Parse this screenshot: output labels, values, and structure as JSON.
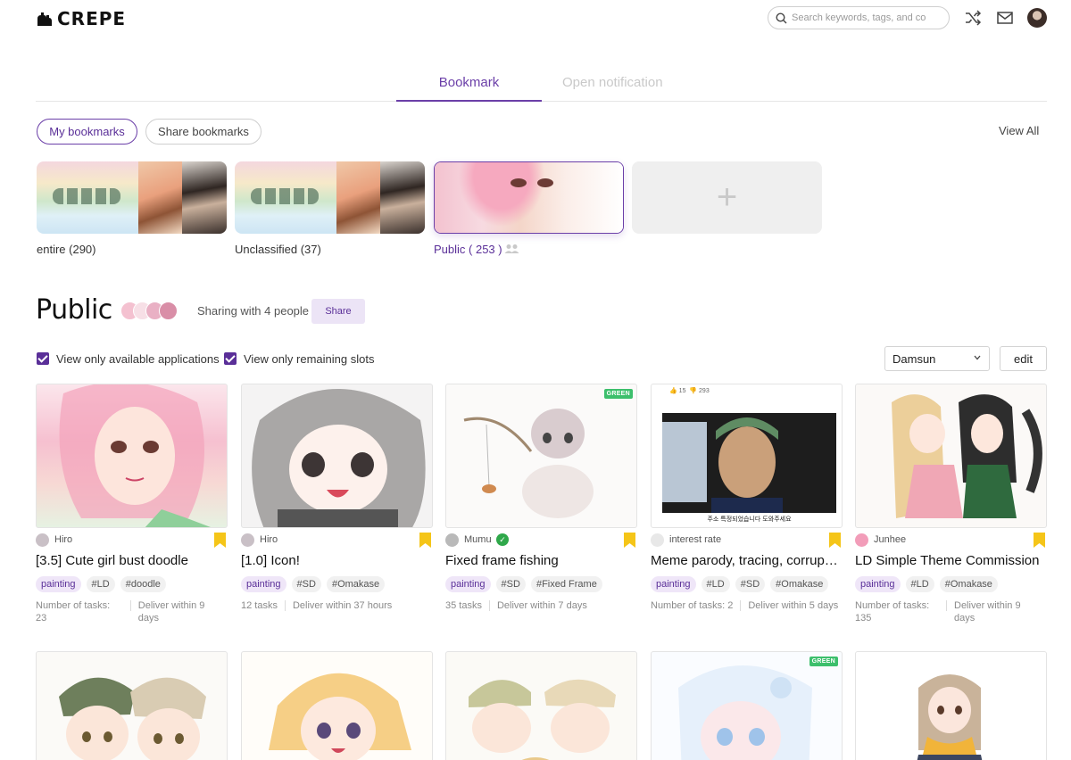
{
  "app": {
    "name": "CREPE"
  },
  "header": {
    "search_placeholder": "Search keywords, tags, and co"
  },
  "tabs": [
    {
      "label": "Bookmark",
      "active": true
    },
    {
      "label": "Open notification",
      "active": false
    }
  ],
  "bookmark_filters": {
    "my": "My bookmarks",
    "share": "Share bookmarks",
    "view_all": "View All"
  },
  "folders": [
    {
      "label": "entire (290)"
    },
    {
      "label": "Unclassified (37)"
    },
    {
      "label": "Public ( 253 )",
      "shared": true
    },
    {
      "label": "+"
    }
  ],
  "public": {
    "title": "Public",
    "sharing_text": "Sharing with 4 people",
    "share_button": "Share",
    "filter_available": "View only available applications",
    "filter_remaining": "View only remaining slots",
    "sort_selected": "Damsun",
    "edit_button": "edit"
  },
  "colors": {
    "accent": "#5a2f98",
    "green_badge": "#3cbf6c",
    "bookmark": "#f5c518"
  },
  "cards": [
    {
      "author": "Hiro",
      "verified": false,
      "title": "[3.5] Cute girl bust doodle",
      "tags": [
        "painting",
        "#LD",
        "#doodle"
      ],
      "tasks": "Number of tasks: 23",
      "deliver": "Deliver within 9 days",
      "badge": ""
    },
    {
      "author": "Hiro",
      "verified": false,
      "title": "[1.0] Icon!",
      "tags": [
        "painting",
        "#SD",
        "#Omakase"
      ],
      "tasks": "12 tasks",
      "deliver": "Deliver within 37 hours",
      "badge": ""
    },
    {
      "author": "Mumu",
      "verified": true,
      "title": "Fixed frame fishing",
      "tags": [
        "painting",
        "#SD",
        "#Fixed Frame"
      ],
      "tasks": "35 tasks",
      "deliver": "Deliver within 7 days",
      "badge": "GREEN"
    },
    {
      "author": "interest rate",
      "verified": false,
      "title": "Meme parody, tracing, corrup…",
      "tags": [
        "painting",
        "#LD",
        "#SD",
        "#Omakase"
      ],
      "tasks": "Number of tasks: 2",
      "deliver": "Deliver within 5 days",
      "badge": ""
    },
    {
      "author": "Junhee",
      "verified": false,
      "title": "LD Simple Theme Commission",
      "tags": [
        "painting",
        "#LD",
        "#Omakase"
      ],
      "tasks": "Number of tasks: 135",
      "deliver": "Deliver within 9 days",
      "badge": ""
    },
    {
      "badge": ""
    },
    {
      "badge": ""
    },
    {
      "badge": ""
    },
    {
      "badge": "GREEN"
    },
    {
      "badge": ""
    }
  ],
  "meme_overlay": {
    "likes": "15",
    "dislikes": "293",
    "caption": "주소 특정되었습니다 도와주세요"
  }
}
